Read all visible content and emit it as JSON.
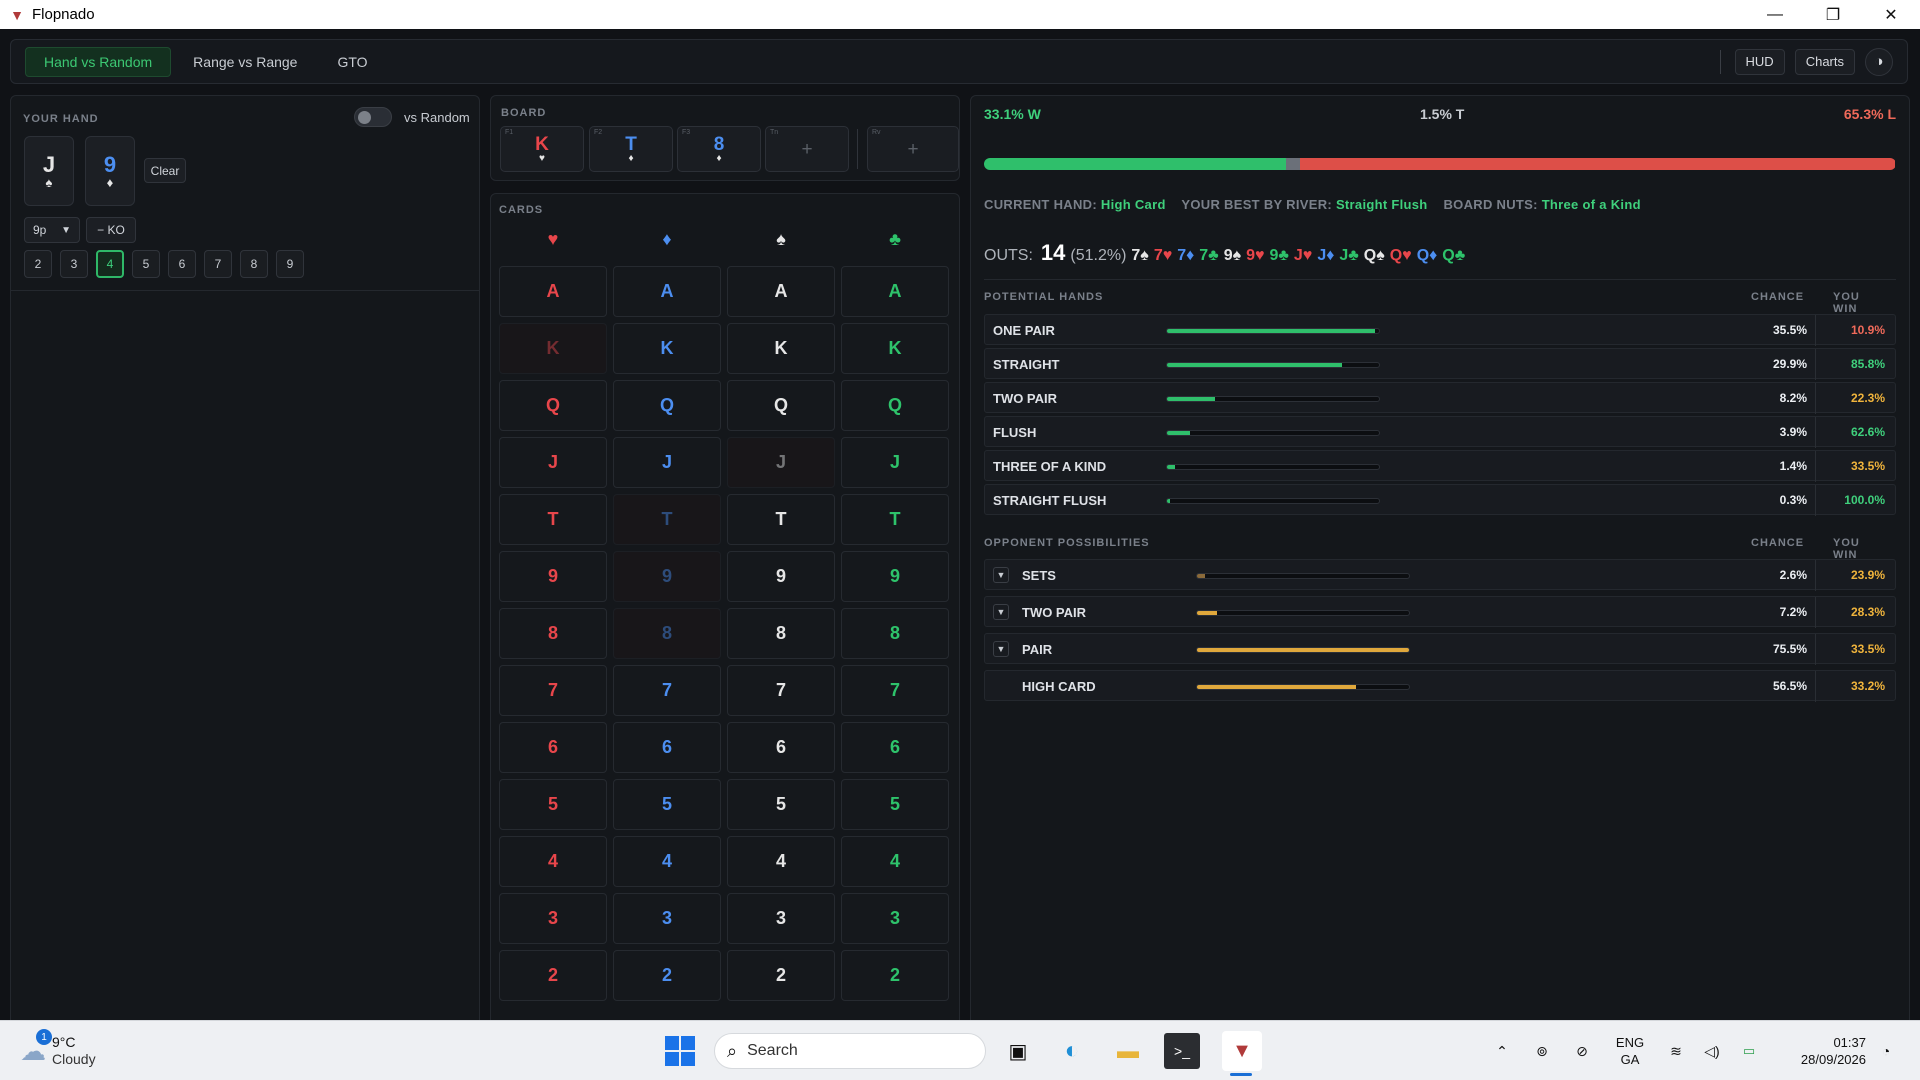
{
  "window": {
    "title": "Flopnado",
    "logo_icon": "flopnado-logo",
    "minimize": "—",
    "maximize": "❐",
    "close": "✕"
  },
  "nav": {
    "tabs": [
      {
        "label": "Hand vs Random",
        "active": true
      },
      {
        "label": "Range vs Range",
        "active": false
      },
      {
        "label": "GTO",
        "active": false
      }
    ],
    "hud": "HUD",
    "charts": "Charts",
    "theme_icon": "◑"
  },
  "your_hand": {
    "title": "YOUR HAND",
    "toggle_label": "vs Random",
    "cards": [
      {
        "rank": "J",
        "suit": "♠",
        "suit_class": "s"
      },
      {
        "rank": "9",
        "suit": "♦",
        "suit_class": "d"
      }
    ],
    "clear": "Clear",
    "players": "9p",
    "ko": "− KO",
    "numbers": [
      "2",
      "3",
      "4",
      "5",
      "6",
      "7",
      "8",
      "9"
    ],
    "selected_number": "4"
  },
  "board": {
    "title": "BOARD",
    "slots": [
      {
        "key": "F1",
        "rank": "K",
        "suit": "♥",
        "suit_class": "h"
      },
      {
        "key": "F2",
        "rank": "T",
        "suit": "♦",
        "suit_class": "d"
      },
      {
        "key": "F3",
        "rank": "8",
        "suit": "♦",
        "suit_class": "d"
      },
      {
        "key": "Tn",
        "rank": "+",
        "suit": "",
        "suit_class": "empty"
      },
      {
        "key": "Rv",
        "rank": "+",
        "suit": "",
        "suit_class": "empty"
      }
    ]
  },
  "cards": {
    "title": "CARDS",
    "suits": [
      {
        "sym": "♥",
        "cls": "h"
      },
      {
        "sym": "♦",
        "cls": "d"
      },
      {
        "sym": "♠",
        "cls": "s"
      },
      {
        "sym": "♣",
        "cls": "c"
      }
    ],
    "ranks": [
      "A",
      "K",
      "Q",
      "J",
      "T",
      "9",
      "8",
      "7",
      "6",
      "5",
      "4",
      "3",
      "2"
    ],
    "used": [
      "K-h",
      "J-s",
      "T-d",
      "9-d",
      "8-d"
    ]
  },
  "equity": {
    "win": "33.1% W",
    "tie": "1.5% T",
    "loss": "65.3% L",
    "win_pct": 33.1,
    "tie_pct": 1.5,
    "loss_pct": 65.3
  },
  "info": {
    "current_label": "CURRENT HAND:",
    "current": "High Card",
    "best_label": "YOUR BEST BY RIVER:",
    "best": "Straight Flush",
    "nuts_label": "BOARD NUTS:",
    "nuts": "Three of a Kind"
  },
  "outs": {
    "label": "OUTS:",
    "count": "14",
    "pct": "(51.2%)",
    "cards": [
      {
        "t": "7♠",
        "c": "s"
      },
      {
        "t": "7♥",
        "c": "h"
      },
      {
        "t": "7♦",
        "c": "d"
      },
      {
        "t": "7♣",
        "c": "c"
      },
      {
        "t": "9♠",
        "c": "s"
      },
      {
        "t": "9♥",
        "c": "h"
      },
      {
        "t": "9♣",
        "c": "c"
      },
      {
        "t": "J♥",
        "c": "h"
      },
      {
        "t": "J♦",
        "c": "d"
      },
      {
        "t": "J♣",
        "c": "c"
      },
      {
        "t": "Q♠",
        "c": "s"
      },
      {
        "t": "Q♥",
        "c": "h"
      },
      {
        "t": "Q♦",
        "c": "d"
      },
      {
        "t": "Q♣",
        "c": "c"
      }
    ]
  },
  "potential": {
    "title": "POTENTIAL HANDS",
    "chance_col": "CHANCE",
    "win_col": "YOU WIN",
    "rows": [
      {
        "name": "ONE PAIR",
        "chance": "35.5%",
        "win": "10.9%",
        "fill": 0.355,
        "win_color": "#f06a5a"
      },
      {
        "name": "STRAIGHT",
        "chance": "29.9%",
        "win": "85.8%",
        "fill": 0.299,
        "win_color": "#3fd07c"
      },
      {
        "name": "TWO PAIR",
        "chance": "8.2%",
        "win": "22.3%",
        "fill": 0.082,
        "win_color": "#f0b43c"
      },
      {
        "name": "FLUSH",
        "chance": "3.9%",
        "win": "62.6%",
        "fill": 0.039,
        "win_color": "#3fd07c"
      },
      {
        "name": "THREE OF A KIND",
        "chance": "1.4%",
        "win": "33.5%",
        "fill": 0.014,
        "win_color": "#f0b43c"
      },
      {
        "name": "STRAIGHT FLUSH",
        "chance": "0.3%",
        "win": "100.0%",
        "fill": 0.003,
        "win_color": "#3fd07c"
      }
    ]
  },
  "opponent": {
    "title": "OPPONENT POSSIBILITIES",
    "chance_col": "CHANCE",
    "win_col": "YOU WIN",
    "rows": [
      {
        "name": "SETS",
        "chance": "2.6%",
        "win": "23.9%",
        "fill": 0.026,
        "expand": "▼"
      },
      {
        "name": "TWO PAIR",
        "chance": "7.2%",
        "win": "28.3%",
        "fill": 0.072,
        "expand": "▼"
      },
      {
        "name": "PAIR",
        "chance": "75.5%",
        "win": "33.5%",
        "fill": 0.755,
        "expand": "▼"
      },
      {
        "name": "HIGH CARD",
        "chance": "56.5%",
        "win": "33.2%",
        "fill": 0.565,
        "expand": ""
      }
    ]
  },
  "taskbar": {
    "temp": "9°C",
    "weather": "Cloudy",
    "badge": "1",
    "search": "Search",
    "lang1": "ENG",
    "lang2": "GA",
    "time": "01:37",
    "date": "28/09/2026"
  }
}
